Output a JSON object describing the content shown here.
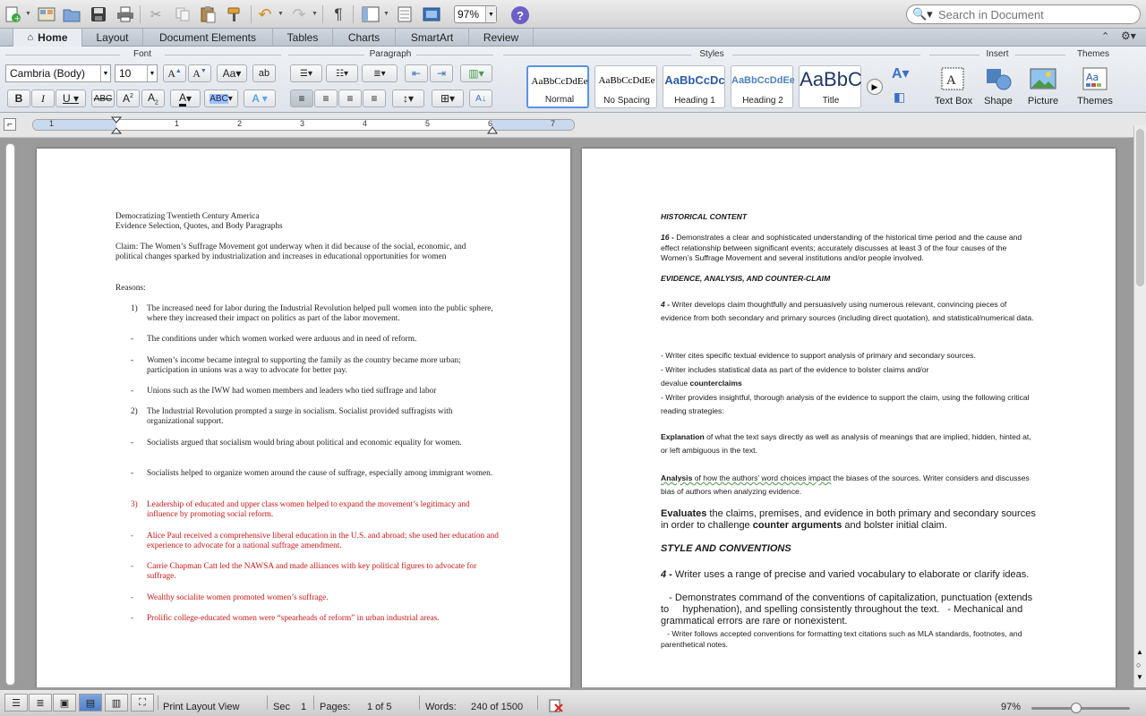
{
  "search": {
    "placeholder": "Search in Document"
  },
  "toolbar": {
    "zoom": "97%"
  },
  "tabs": [
    "Home",
    "Layout",
    "Document Elements",
    "Tables",
    "Charts",
    "SmartArt",
    "Review"
  ],
  "ribbon": {
    "groups": {
      "font": "Font",
      "paragraph": "Paragraph",
      "styles": "Styles",
      "insert": "Insert",
      "themes": "Themes"
    },
    "font_name": "Cambria (Body)",
    "font_size": "10",
    "styles": [
      {
        "sample": "AaBbCcDdEe",
        "label": "Normal"
      },
      {
        "sample": "AaBbCcDdEe",
        "label": "No Spacing"
      },
      {
        "sample": "AaBbCcDc",
        "label": "Heading 1"
      },
      {
        "sample": "AaBbCcDdEe",
        "label": "Heading 2"
      },
      {
        "sample": "AaBbC",
        "label": "Title"
      }
    ],
    "insert": {
      "textbox": "Text Box",
      "shape": "Shape",
      "picture": "Picture"
    },
    "themes": "Themes"
  },
  "ruler": {
    "numbers": [
      "1",
      "1",
      "2",
      "3",
      "4",
      "5",
      "6",
      "7"
    ]
  },
  "page1": {
    "title1": "Democratizing Twentieth Century America",
    "title2": "Evidence Selection, Quotes, and Body Paragraphs",
    "claim": "Claim: The Women’s Suffrage Movement got underway when it did because of the social, economic, and political changes sparked by industrialization and increases in educational opportunities for women",
    "reasons": "Reasons:",
    "items": [
      {
        "marker": "1)",
        "text": "The increased need for labor during the Industrial Revolution helped pull women into the public sphere, where they increased their impact on politics as part of the labor movement."
      },
      {
        "marker": "-",
        "text": "The conditions under which women worked were arduous and in need of reform."
      },
      {
        "marker": "-",
        "text": "Women’s income became integral to supporting the family as the country became more urban; participation in unions was a way to advocate for better pay."
      },
      {
        "marker": "-",
        "text": "Unions such as the IWW had women members and leaders who tied suffrage and labor"
      },
      {
        "marker": "2)",
        "text": "The Industrial Revolution prompted a surge in socialism.  Socialist provided suffragists with organizational support."
      },
      {
        "marker": "-",
        "text": "Socialists argued that socialism would bring about political and economic equality for women."
      },
      {
        "marker": "-",
        "text": "Socialists helped to organize women around the cause of suffrage, especially among immigrant women."
      },
      {
        "marker": "3)",
        "text": "Leadership of educated and upper class women helped to expand the movement’s legitimacy and influence by promoting social reform."
      },
      {
        "marker": "-",
        "text": "Alice Paul received a comprehensive liberal education in the U.S. and abroad; she used her education and experience to advocate for a national suffrage amendment."
      },
      {
        "marker": "-",
        "text": "Carrie Chapman Catt led the NAWSA and made alliances with key political figures to advocate for suffrage."
      },
      {
        "marker": "-",
        "text": "Wealthy socialite women promoted women’s suffrage."
      },
      {
        "marker": "-",
        "text": "Prolific college-educated women were “spearheads of reform” in urban industrial areas."
      }
    ]
  },
  "page2": {
    "h1": "HISTORICAL CONTENT",
    "hist_score": "16 -",
    "hist_text": " Demonstrates a clear and sophisticated understanding of the historical time period and the cause and effect relationship between significant events; accurately discusses at least 3 of the four causes of the Women’s Suffrage Movement and several institutions and/or people involved.",
    "h2": "EVIDENCE, ANALYSIS, AND COUNTER-CLAIM",
    "ev_score": "4 -",
    "ev_text": " Writer develops claim thoughtfully and persuasively using numerous relevant, convincing pieces of evidence from both secondary and primary sources (including direct quotation), and statistical/numerical data.",
    "ev_b1": "- Writer cites specific textual evidence to support analysis of primary and secondary sources.",
    "ev_b2": "- Writer includes statistical data as part of the evidence to bolster claims and/or",
    "ev_b3a": "devalue ",
    "ev_b3b": "counterclaims",
    "ev_b4": "- Writer provides insightful, thorough analysis of the evidence to support the claim, using the following critical reading strategies:",
    "expl_b": "Explanation",
    "expl_t": " of what the text says directly as well as analysis of meanings that are implied, hidden, hinted at, or left ambiguous in the text.",
    "anal_b": "Analysis",
    "anal_u": " of how the authors’ word choices impact",
    "anal_t": " the biases of the sources.  Writer considers and discusses bias of authors when analyzing evidence.",
    "eval_b": "Evaluates",
    "eval_t1": " the claims, premises, and evidence in both primary and secondary sources in order to challenge ",
    "eval_b2": "counter arguments",
    "eval_t2": " and bolster initial claim.",
    "h3": "STYLE AND CONVENTIONS",
    "st_score": "4 -",
    "st_text": " Writer uses a range of precise and varied vocabulary to elaborate or clarify ideas.",
    "st_b1": "   - Demonstrates command of the conventions of capitalization, punctuation (extends to     hyphenation), and spelling consistently throughout the text.   - Mechanical and grammatical errors are rare or nonexistent.",
    "st_b2": "   - Writer follows accepted conventions for formatting text citations such as MLA standards, footnotes, and parenthetical notes."
  },
  "status": {
    "view": "Print Layout View",
    "sec_label": "Sec",
    "sec_val": "1",
    "pages_label": "Pages:",
    "pages_val": "1 of 5",
    "words_label": "Words:",
    "words_val": "240 of 1500",
    "zoom": "97%"
  }
}
